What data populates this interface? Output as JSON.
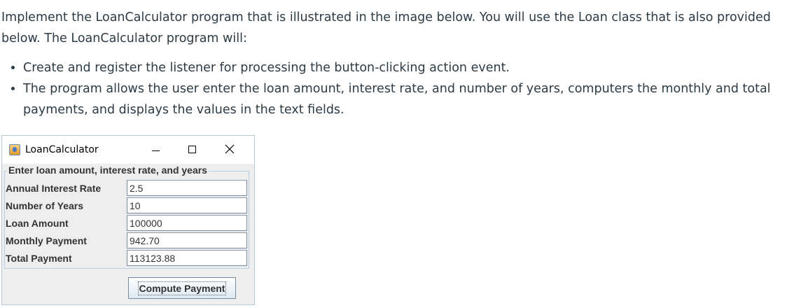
{
  "prose": {
    "paragraph": "Implement the LoanCalculator program that is illustrated in the image below. You will use the Loan class that is also provided below. The LoanCalculator program will:",
    "bullets": [
      "Create and register the listener for processing the button-clicking action event.",
      "The program allows the user enter the loan amount, interest rate, and number of years, computers the monthly and total payments, and displays the values in the text fields."
    ]
  },
  "window": {
    "title": "LoanCalculator",
    "icons": {
      "app": "java-app-icon",
      "minimize": "minimize-icon",
      "maximize": "maximize-icon",
      "close": "close-icon"
    },
    "panel_title": "Enter loan amount, interest rate, and years",
    "fields": [
      {
        "label": "Annual Interest Rate",
        "value": "2.5"
      },
      {
        "label": "Number of Years",
        "value": "10"
      },
      {
        "label": "Loan Amount",
        "value": "100000"
      },
      {
        "label": "Monthly Payment",
        "value": "942.70"
      },
      {
        "label": "Total Payment",
        "value": "113123.88"
      }
    ],
    "button_label": "Compute Payment"
  }
}
